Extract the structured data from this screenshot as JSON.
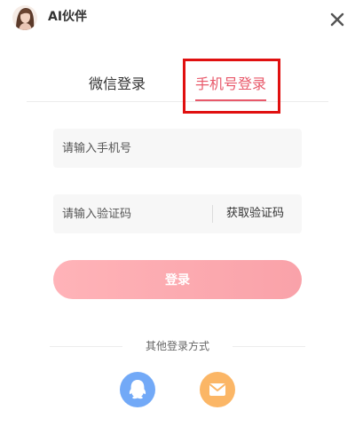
{
  "app": {
    "name": "AI伙伴"
  },
  "tabs": [
    {
      "label": "微信登录",
      "active": false
    },
    {
      "label": "手机号登录",
      "active": true
    }
  ],
  "form": {
    "phone_placeholder": "请输入手机号",
    "code_placeholder": "请输入验证码",
    "get_code_label": "获取验证码",
    "login_label": "登录"
  },
  "other_methods": {
    "label": "其他登录方式",
    "items": [
      {
        "icon": "qq-icon",
        "color": "#72a9f7"
      },
      {
        "icon": "mail-icon",
        "color": "#fbb666"
      }
    ]
  },
  "colors": {
    "accent": "#e8596a",
    "highlight": "#e01010",
    "login_gradient_start": "#ffb3b8",
    "login_gradient_end": "#f9a2a9"
  }
}
